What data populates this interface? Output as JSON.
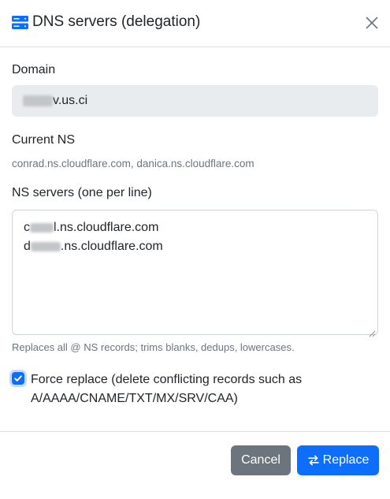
{
  "dialog": {
    "title": "DNS servers (delegation)",
    "title_icon": "server-icon",
    "close_icon": "close-icon"
  },
  "domain": {
    "label": "Domain",
    "value_suffix": "v.us.ci"
  },
  "current_ns": {
    "label": "Current NS",
    "value": "conrad.ns.cloudflare.com, danica.ns.cloudflare.com"
  },
  "ns_servers": {
    "label": "NS servers (one per line)",
    "lines": [
      {
        "prefix": "c",
        "suffix": "l.ns.cloudflare.com"
      },
      {
        "prefix": "d",
        "suffix": ".ns.cloudflare.com"
      }
    ],
    "hint": "Replaces all @ NS records; trims blanks, dedups, lowercases."
  },
  "force_replace": {
    "checked": true,
    "label": "Force replace (delete conflicting records such as A/AAAA/CNAME/TXT/MX/SRV/CAA)"
  },
  "buttons": {
    "cancel": "Cancel",
    "replace": "Replace",
    "replace_icon": "swap-arrows-icon"
  },
  "colors": {
    "primary": "#0d6efd",
    "secondary": "#6c757d",
    "input_bg": "#e9ecef"
  }
}
